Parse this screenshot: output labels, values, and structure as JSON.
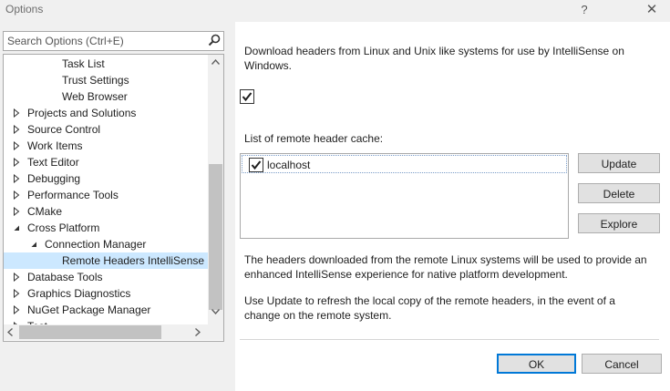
{
  "window": {
    "title": "Options",
    "help_glyph": "?",
    "close_glyph": "✕"
  },
  "search": {
    "placeholder": "Search Options (Ctrl+E)"
  },
  "tree": {
    "items": [
      {
        "label": "Task List",
        "level": 2,
        "expander": "none",
        "selected": false
      },
      {
        "label": "Trust Settings",
        "level": 2,
        "expander": "none",
        "selected": false
      },
      {
        "label": "Web Browser",
        "level": 2,
        "expander": "none",
        "selected": false
      },
      {
        "label": "Projects and Solutions",
        "level": 0,
        "expander": "collapsed",
        "selected": false
      },
      {
        "label": "Source Control",
        "level": 0,
        "expander": "collapsed",
        "selected": false
      },
      {
        "label": "Work Items",
        "level": 0,
        "expander": "collapsed",
        "selected": false
      },
      {
        "label": "Text Editor",
        "level": 0,
        "expander": "collapsed",
        "selected": false
      },
      {
        "label": "Debugging",
        "level": 0,
        "expander": "collapsed",
        "selected": false
      },
      {
        "label": "Performance Tools",
        "level": 0,
        "expander": "collapsed",
        "selected": false
      },
      {
        "label": "CMake",
        "level": 0,
        "expander": "collapsed",
        "selected": false
      },
      {
        "label": "Cross Platform",
        "level": 0,
        "expander": "expanded",
        "selected": false
      },
      {
        "label": "Connection Manager",
        "level": 1,
        "expander": "expanded",
        "selected": false
      },
      {
        "label": "Remote Headers IntelliSense Manager",
        "level": 2,
        "expander": "none",
        "selected": true
      },
      {
        "label": "Database Tools",
        "level": 0,
        "expander": "collapsed",
        "selected": false
      },
      {
        "label": "Graphics Diagnostics",
        "level": 0,
        "expander": "collapsed",
        "selected": false
      },
      {
        "label": "NuGet Package Manager",
        "level": 0,
        "expander": "collapsed",
        "selected": false
      },
      {
        "label": "Test",
        "level": 0,
        "expander": "collapsed",
        "selected": false
      }
    ]
  },
  "panel": {
    "description": "Download headers from Linux and Unix like systems for use by IntelliSense on Windows.",
    "enable_checked": true,
    "cache_label": "List of remote header cache:",
    "cache_items": [
      {
        "label": "localhost",
        "checked": true
      }
    ],
    "buttons": {
      "update": "Update",
      "delete": "Delete",
      "explore": "Explore"
    },
    "info1": "The headers downloaded from the remote Linux systems will be used to provide an enhanced IntelliSense experience for native platform development.",
    "info2": "Use Update to refresh the local copy of the remote headers, in the event of a change on the remote system."
  },
  "footer": {
    "ok": "OK",
    "cancel": "Cancel"
  },
  "colors": {
    "selection": "#cce8ff",
    "accent": "#0078d7",
    "chrome": "#f0f0f0"
  }
}
